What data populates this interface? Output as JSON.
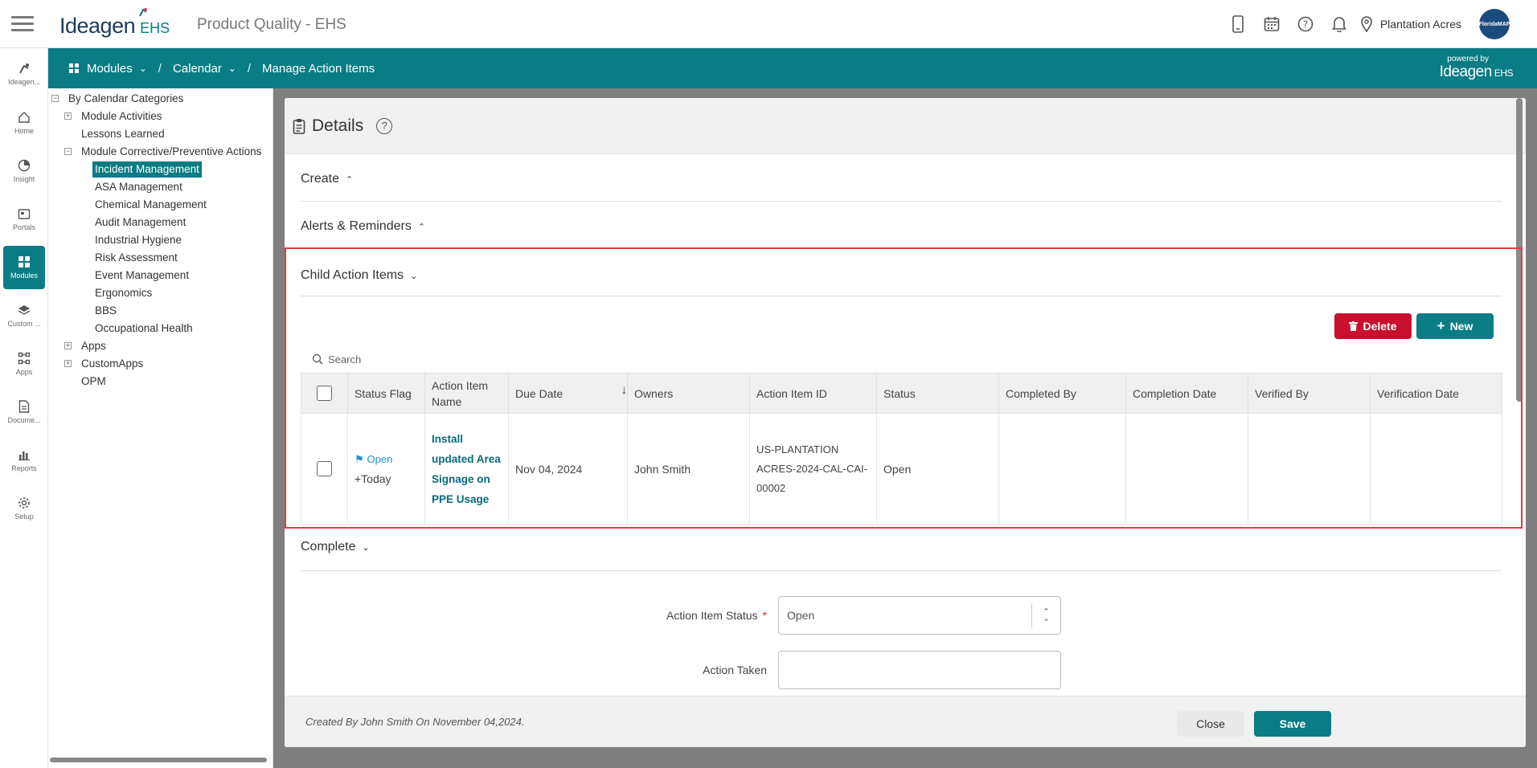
{
  "header": {
    "brand": "Ideagen",
    "brand_suffix": "EHS",
    "app_title": "Product Quality - EHS",
    "location": "Plantation Acres",
    "avatar_text": "FloridaMAP",
    "icons": [
      "mobile-icon",
      "calendar-icon",
      "help-icon",
      "bell-icon",
      "location-pin-icon"
    ]
  },
  "subbar": {
    "breadcrumbs": [
      "Modules",
      "Calendar",
      "Manage Action Items"
    ],
    "powered_by": "powered by",
    "powered_brand": "Ideagen",
    "powered_suffix": "EHS"
  },
  "leftnav": {
    "items": [
      {
        "label": "Ideagen...",
        "icon": "ideagen-icon"
      },
      {
        "label": "Home",
        "icon": "home-icon"
      },
      {
        "label": "Insight",
        "icon": "pie-chart-icon"
      },
      {
        "label": "Portals",
        "icon": "portal-icon"
      },
      {
        "label": "Modules",
        "icon": "grid-icon",
        "active": true
      },
      {
        "label": "Custom ...",
        "icon": "layers-icon"
      },
      {
        "label": "Apps",
        "icon": "apps-icon"
      },
      {
        "label": "Docume...",
        "icon": "document-icon"
      },
      {
        "label": "Reports",
        "icon": "bar-chart-icon"
      },
      {
        "label": "Setup",
        "icon": "gear-icon"
      }
    ]
  },
  "tree": {
    "root": "By Calendar Categories",
    "module_activities": "Module Activities",
    "lessons_learned": "Lessons Learned",
    "module_corrective": "Module Corrective/Preventive Actions",
    "children": [
      "Incident Management",
      "ASA Management",
      "Chemical Management",
      "Audit Management",
      "Industrial Hygiene",
      "Risk Assessment",
      "Event Management",
      "Ergonomics",
      "BBS",
      "Occupational Health"
    ],
    "apps": "Apps",
    "custom_apps": "CustomApps",
    "opm": "OPM"
  },
  "modal": {
    "title": "Details",
    "help": "?",
    "sections": {
      "create": "Create",
      "alerts": "Alerts & Reminders",
      "child": "Child Action Items",
      "complete": "Complete"
    },
    "delete_label": "Delete",
    "new_label": "New",
    "search_placeholder": "Search",
    "columns": [
      "Status Flag",
      "Action Item Name",
      "Due Date",
      "Owners",
      "Action Item ID",
      "Status",
      "Completed By",
      "Completion Date",
      "Verified By",
      "Verification Date"
    ],
    "row": {
      "flag_status": "Open",
      "flag_sub": "+Today",
      "name": "Install updated Area Signage on PPE Usage",
      "due_date": "Nov 04, 2024",
      "owners": "John Smith",
      "action_item_id": "US-PLANTATION ACRES-2024-CAL-CAI-00002",
      "status": "Open",
      "completed_by": "",
      "completion_date": "",
      "verified_by": "",
      "verification_date": ""
    },
    "form": {
      "status_label": "Action Item Status",
      "required_mark": "*",
      "status_value": "Open",
      "action_taken_label": "Action Taken",
      "action_taken_value": ""
    },
    "footer": {
      "created": "Created By  John Smith On November 04,2024.",
      "close": "Close",
      "save": "Save"
    }
  },
  "colors": {
    "teal": "#0a7c83",
    "danger": "#c8102e",
    "highlight": "#e23b3b"
  }
}
